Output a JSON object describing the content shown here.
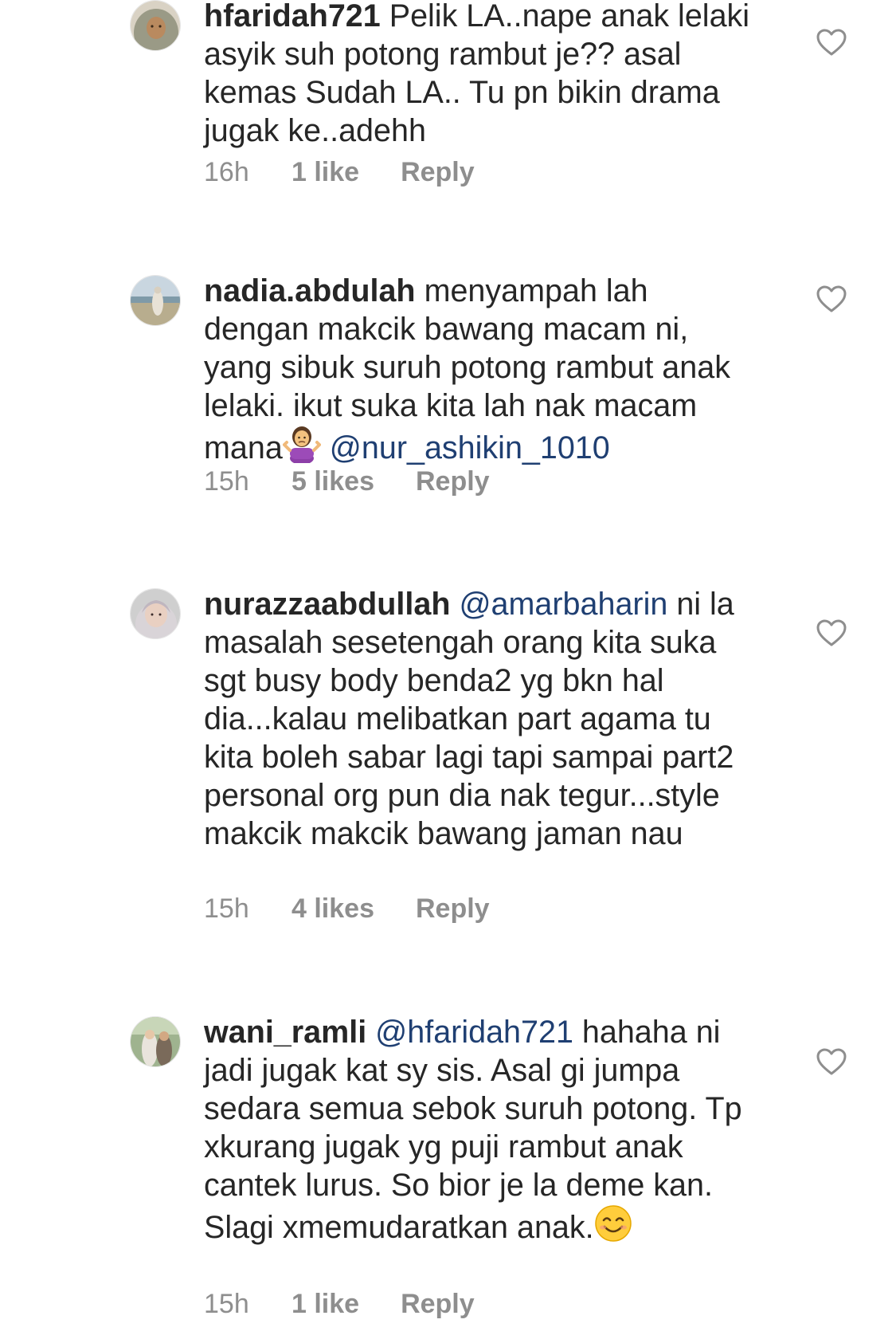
{
  "colors": {
    "text": "#262626",
    "meta": "#8e8e8e",
    "mention": "#1f3f72",
    "background": "#ffffff"
  },
  "comments": [
    {
      "username": "hfaridah721",
      "mention": "",
      "text": "Pelik LA..nape anak lelaki asyik suh potong rambut je?? asal kemas Sudah LA.. Tu pn bikin drama jugak ke..adehh",
      "time": "16h",
      "likes": "1 like",
      "reply": "Reply",
      "avatar": "avatar-hijab-girl",
      "like_icon": "heart-outline-icon"
    },
    {
      "username": "nadia.abdulah",
      "text": "menyampah lah dengan makcik bawang macam ni, yang sibuk suruh potong rambut anak lelaki. ikut suka kita lah nak macam mana",
      "emoji": "woman-shrugging-emoji",
      "mention_after": "@nur_ashikin_1010",
      "time": "15h",
      "likes": "5 likes",
      "reply": "Reply",
      "avatar": "avatar-beach-photo",
      "like_icon": "heart-outline-icon"
    },
    {
      "username": "nurazzaabdullah",
      "mention": "@amarbaharin",
      "text": "ni la masalah sesetengah orang kita suka sgt busy body benda2 yg bkn hal dia...kalau melibatkan part agama tu kita boleh sabar lagi tapi sampai part2 personal org pun dia nak tegur...style makcik makcik bawang jaman nau",
      "time": "15h",
      "likes": "4 likes",
      "reply": "Reply",
      "avatar": "avatar-hijab-woman",
      "like_icon": "heart-outline-icon"
    },
    {
      "username": "wani_ramli",
      "mention": "@hfaridah721",
      "text": "hahaha ni jadi jugak kat sy sis. Asal gi jumpa sedara semua sebok suruh potong. Tp xkurang jugak yg puji rambut anak cantek lurus. So bior je la deme kan. Slagi xmemudaratkan anak.",
      "emoji": "smiling-face-emoji",
      "time": "15h",
      "likes": "1 like",
      "reply": "Reply",
      "avatar": "avatar-couple-photo",
      "like_icon": "heart-outline-icon"
    }
  ]
}
